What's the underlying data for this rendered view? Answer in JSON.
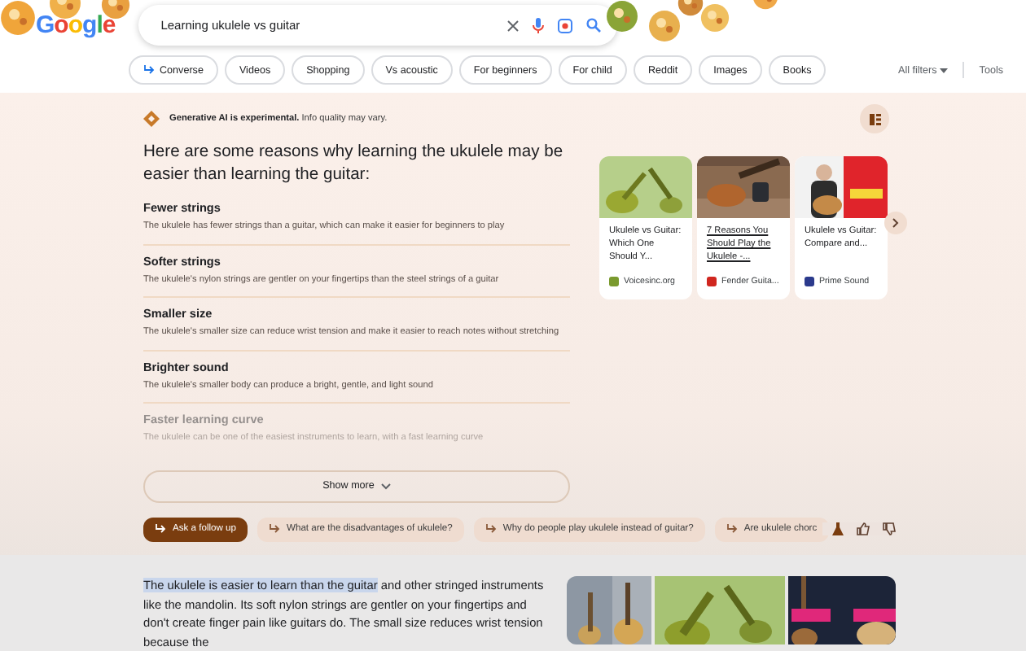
{
  "logo": {
    "text": "Google"
  },
  "search": {
    "query": "Learning ukulele vs guitar"
  },
  "chips": [
    {
      "label": "Converse",
      "kind": "action"
    },
    {
      "label": "Videos",
      "kind": "plain"
    },
    {
      "label": "Shopping",
      "kind": "plain"
    },
    {
      "label": "Vs acoustic",
      "kind": "plain"
    },
    {
      "label": "For beginners",
      "kind": "plain"
    },
    {
      "label": "For child",
      "kind": "plain"
    },
    {
      "label": "Reddit",
      "kind": "plain"
    },
    {
      "label": "Images",
      "kind": "plain"
    },
    {
      "label": "Books",
      "kind": "plain"
    }
  ],
  "filters": {
    "all_filters": "All filters",
    "tools": "Tools"
  },
  "ai_overview": {
    "notice": "**Generative AI is experimental.** Info quality may vary.",
    "heading": "Here are some reasons why learning the ukulele may be easier than learning the guitar:",
    "reasons": [
      {
        "title": "Fewer strings",
        "text": "The ukulele has fewer strings than a guitar, which can make it easier for beginners to play",
        "faded": false
      },
      {
        "title": "Softer strings",
        "text": "The ukulele's nylon strings are gentler on your fingertips than the steel strings of a guitar",
        "faded": false
      },
      {
        "title": "Smaller size",
        "text": "The ukulele's smaller size can reduce wrist tension and make it easier to reach notes without stretching",
        "faded": false
      },
      {
        "title": "Brighter sound",
        "text": "The ukulele's smaller body can produce a bright, gentle, and light sound",
        "faded": false
      },
      {
        "title": "Faster learning curve",
        "text": "The ukulele can be one of the easiest instruments to learn, with a fast learning curve",
        "faded": true
      }
    ],
    "show_more": "Show more",
    "sources": [
      {
        "title": "Ukulele vs Guitar: Which One Should Y...",
        "site": "Voicesinc.org",
        "underlined": false
      },
      {
        "title": "7 Reasons You Should Play the Ukulele -...",
        "site": "Fender Guita...",
        "underlined": true
      },
      {
        "title": "Ukulele vs Guitar: Compare and...",
        "site": "Prime Sound",
        "underlined": false
      }
    ],
    "follow_up": "Ask a follow up",
    "suggestions": [
      "What are the disadvantages of ukulele?",
      "Why do people play ukulele instead of guitar?",
      "Are ukulele chorc"
    ]
  },
  "snippet": {
    "highlight": "The ukulele is easier to learn than the guitar",
    "rest": " and other stringed instruments like the mandolin. Its soft nylon strings are gentler on your fingertips and don't create finger pain like guitars do. The small size reduces wrist tension because the"
  }
}
